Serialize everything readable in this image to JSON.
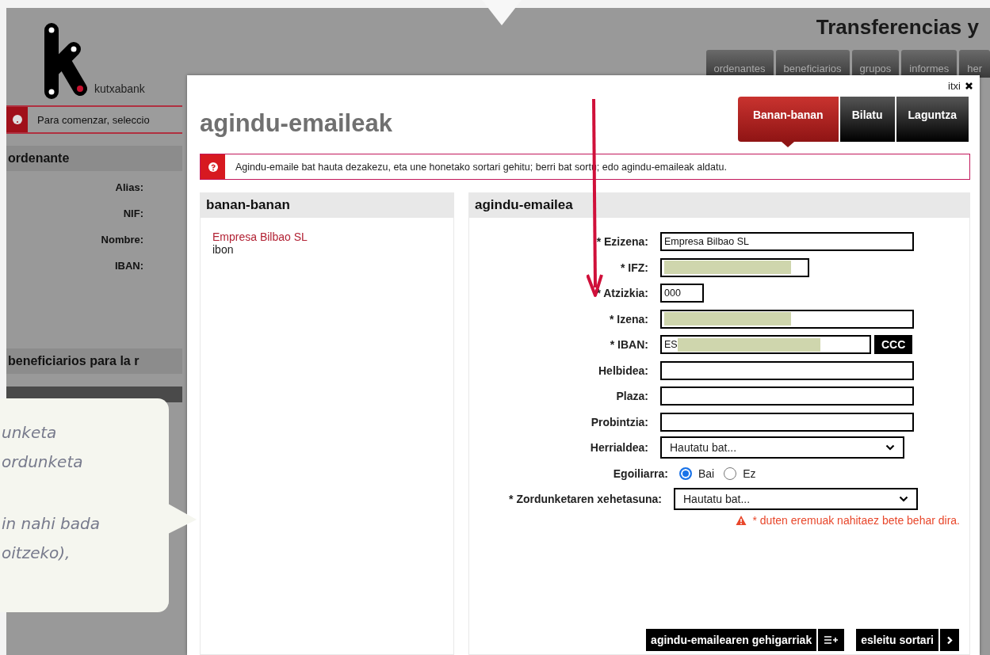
{
  "background_page": {
    "logo_text": "kutxabank",
    "header_title": "Transferencias y",
    "nav_tabs": [
      {
        "label": "ordenantes"
      },
      {
        "label": "beneficiarios"
      },
      {
        "label": "grupos"
      },
      {
        "label": "informes"
      },
      {
        "label": "her"
      }
    ],
    "message": "Para comenzar, seleccio",
    "ordenante": {
      "title": "ordenante",
      "labels": [
        "Alias:",
        "NIF:",
        "Nombre:",
        "IBAN:"
      ]
    },
    "beneficiarios_title": "beneficiarios para la r"
  },
  "dialog": {
    "close_label": "itxi",
    "title": "agindu-emaileak",
    "tabs": [
      {
        "label": "Banan-banan",
        "selected": true
      },
      {
        "label": "Bilatu",
        "selected": false
      },
      {
        "label": "Laguntza",
        "selected": false
      }
    ],
    "message": "Agindu-emaile bat hauta dezakezu, eta une honetako sortari gehitu; berri bat sortu; edo agindu-emaileak aldatu.",
    "list_panel": {
      "title": "banan-banan",
      "items": [
        {
          "name": "Empresa Bilbao SL",
          "detail": "ibon"
        }
      ]
    },
    "form_panel": {
      "title": "agindu-emailea",
      "fields": [
        {
          "kind": "text",
          "label": "* Ezizena:",
          "value": "Empresa Bilbao SL"
        },
        {
          "kind": "text",
          "label": "* IFZ:",
          "redacted": true
        },
        {
          "kind": "text",
          "label": "* Atzizkia:",
          "value": "000"
        },
        {
          "kind": "text",
          "label": "* Izena:",
          "redacted": true
        },
        {
          "kind": "text",
          "label": "* IBAN:",
          "value": "ES",
          "redacted": true,
          "button": "CCC"
        },
        {
          "kind": "text",
          "label": "Helbidea:"
        },
        {
          "kind": "text",
          "label": "Plaza:"
        },
        {
          "kind": "text",
          "label": "Probintzia:"
        },
        {
          "kind": "select",
          "label": "Herrialdea:",
          "value": "Hautatu bat..."
        },
        {
          "kind": "radio",
          "label": "Egoiliarra:",
          "options": [
            {
              "label": "Bai",
              "selected": true
            },
            {
              "label": "Ez",
              "selected": false
            }
          ]
        },
        {
          "kind": "select",
          "label": "* Zordunketaren xehetasuna:",
          "value": "Hautatu bat..."
        }
      ],
      "notice": "* duten eremuak nahitaez bete behar dira.",
      "buttons": [
        {
          "label": "agindu-emailearen gehigarriak"
        },
        {
          "label": "esleitu sortari"
        }
      ]
    }
  },
  "callout": {
    "paragraphs": [
      {
        "lines": [
          "unketa",
          "ordunketa"
        ]
      },
      {
        "lines": [
          "in nahi bada",
          "oitzeko),"
        ]
      }
    ]
  }
}
